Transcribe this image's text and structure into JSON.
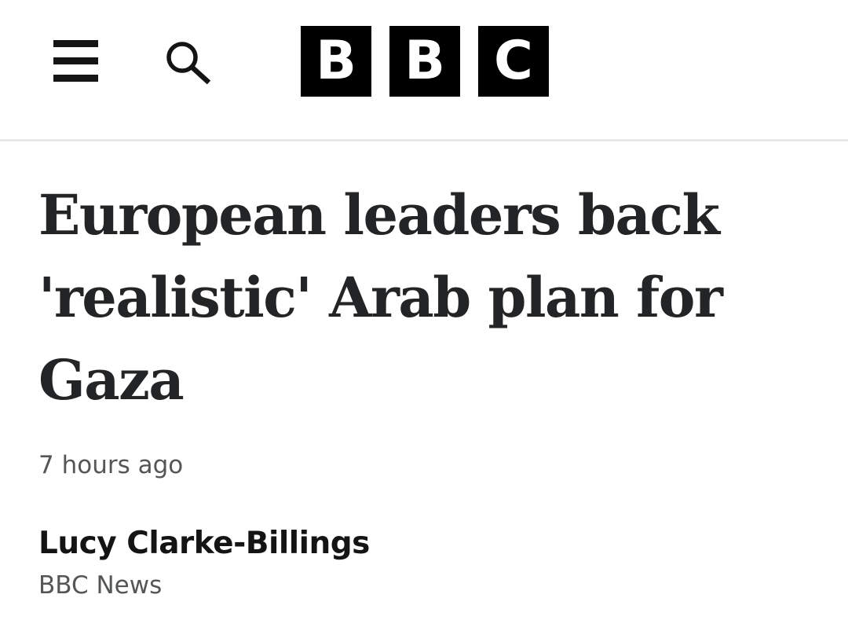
{
  "header": {
    "logo": {
      "letters": [
        "B",
        "B",
        "C"
      ],
      "color": "#000000"
    },
    "menu_icon": "hamburger-menu-icon",
    "search_icon": "search-icon"
  },
  "article": {
    "headline": "European leaders back 'realistic' Arab plan for Gaza",
    "timestamp": "7 hours ago",
    "author": "Lucy Clarke-Billings",
    "organization": "BBC News"
  },
  "colors": {
    "text": "#222426",
    "muted": "#545658",
    "divider": "#e6e8ea"
  }
}
